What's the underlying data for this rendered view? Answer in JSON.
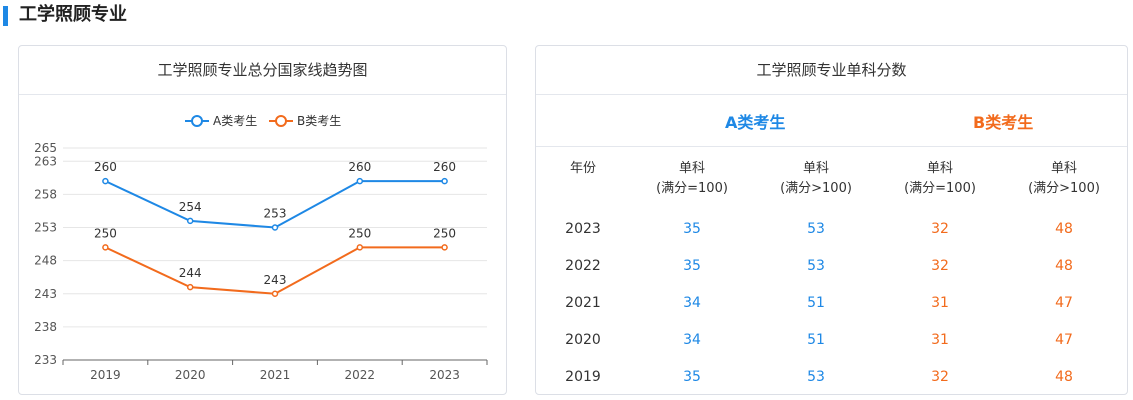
{
  "section": {
    "title": "工学照顾专业"
  },
  "chart_card": {
    "title": "工学照顾专业总分国家线趋势图"
  },
  "chart_data": {
    "type": "line",
    "title": "工学照顾专业总分国家线趋势图",
    "categories": [
      "2019",
      "2020",
      "2021",
      "2022",
      "2023"
    ],
    "series": [
      {
        "name": "A类考生",
        "values": [
          260,
          254,
          253,
          260,
          260
        ],
        "color": "#1e88e5"
      },
      {
        "name": "B类考生",
        "values": [
          250,
          244,
          243,
          250,
          250
        ],
        "color": "#f26b1d"
      }
    ],
    "yticks": [
      233,
      238,
      243,
      248,
      253,
      258,
      263,
      265
    ],
    "ylim": [
      233,
      265
    ],
    "legend": "top-center",
    "grid": true
  },
  "table_card": {
    "title": "工学照顾专业单科分数",
    "group_a": "A类考生",
    "group_b": "B类考生",
    "headers": {
      "year": "年份",
      "a1_line1": "单科",
      "a1_line2": "(满分=100)",
      "a2_line1": "单科",
      "a2_line2": "(满分>100)",
      "b1_line1": "单科",
      "b1_line2": "(满分=100)",
      "b2_line1": "单科",
      "b2_line2": "(满分>100)"
    },
    "rows": [
      {
        "year": "2023",
        "a1": "35",
        "a2": "53",
        "b1": "32",
        "b2": "48"
      },
      {
        "year": "2022",
        "a1": "35",
        "a2": "53",
        "b1": "32",
        "b2": "48"
      },
      {
        "year": "2021",
        "a1": "34",
        "a2": "51",
        "b1": "31",
        "b2": "47"
      },
      {
        "year": "2020",
        "a1": "34",
        "a2": "51",
        "b1": "31",
        "b2": "47"
      },
      {
        "year": "2019",
        "a1": "35",
        "a2": "53",
        "b1": "32",
        "b2": "48"
      }
    ]
  }
}
